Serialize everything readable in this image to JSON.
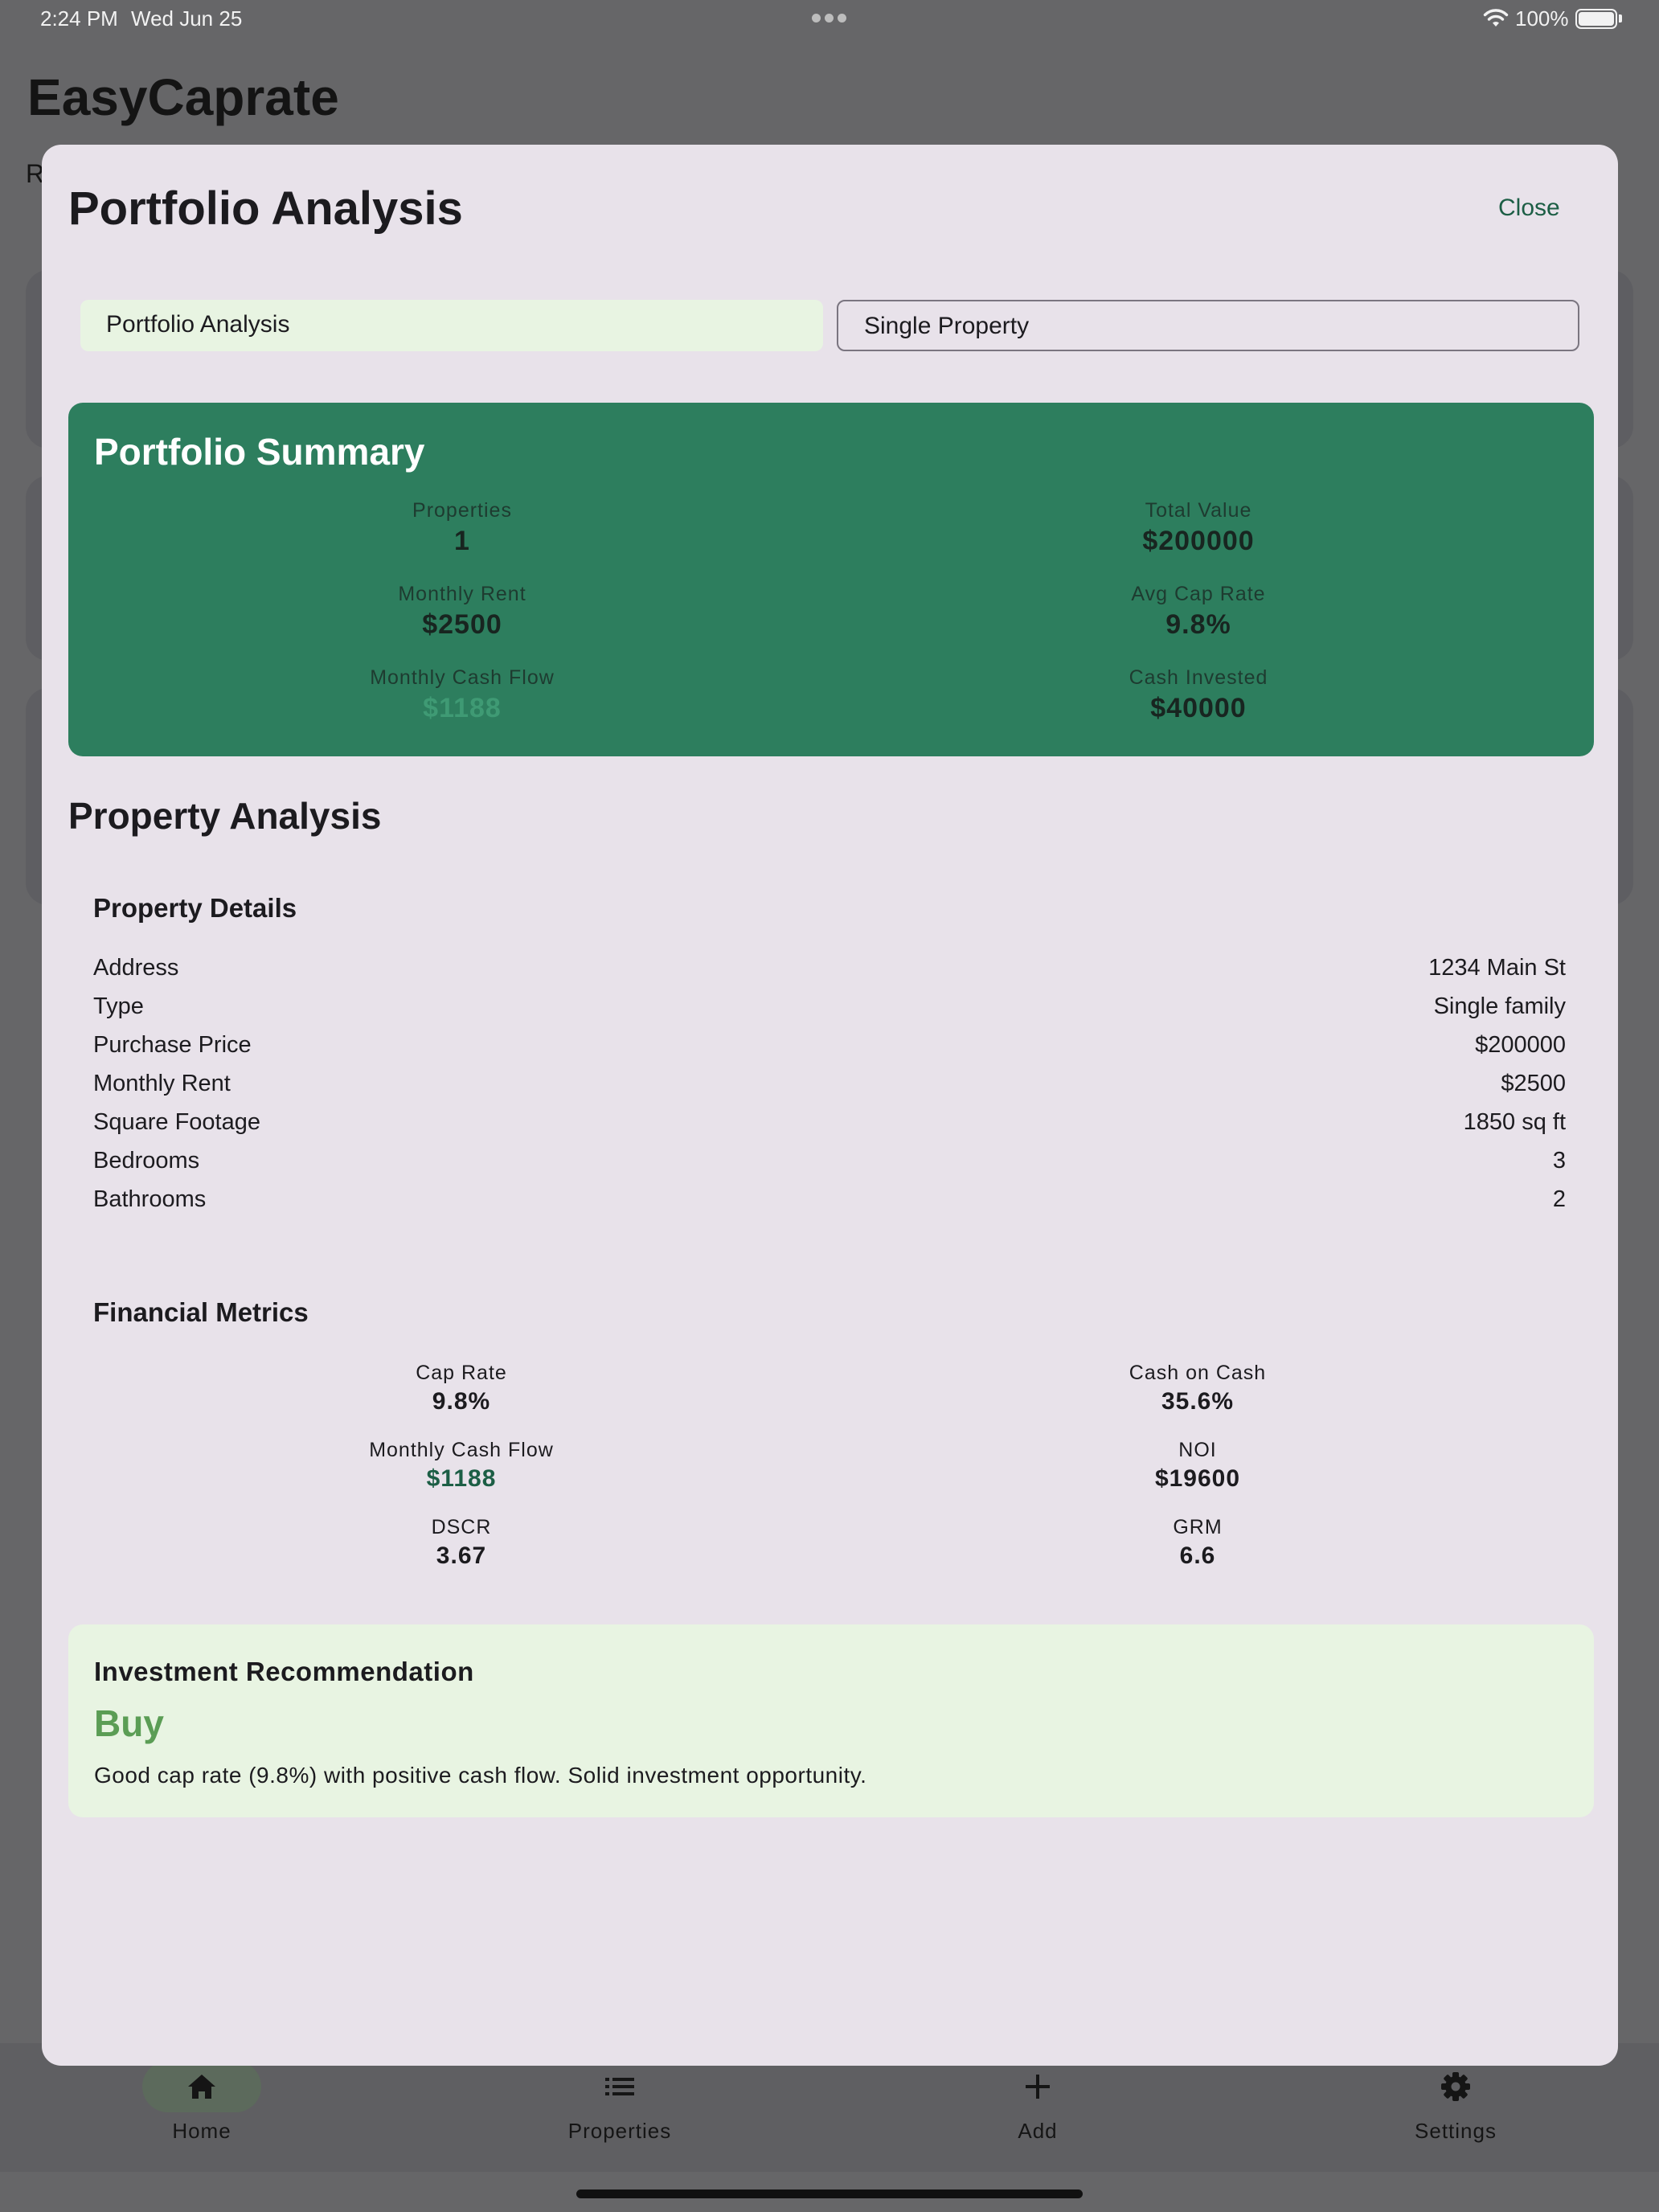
{
  "status_bar": {
    "time": "2:24 PM",
    "date": "Wed Jun 25",
    "battery": "100%"
  },
  "background": {
    "app_title": "EasyCaprate",
    "subtitle_partial": "R"
  },
  "modal": {
    "title": "Portfolio Analysis",
    "close_label": "Close",
    "segments": [
      {
        "label": "Portfolio Analysis",
        "selected": true
      },
      {
        "label": "Single Property",
        "selected": false
      }
    ]
  },
  "summary": {
    "title": "Portfolio Summary",
    "metrics": [
      {
        "label": "Properties",
        "value": "1"
      },
      {
        "label": "Total Value",
        "value": "$200000"
      },
      {
        "label": "Monthly Rent",
        "value": "$2500"
      },
      {
        "label": "Avg Cap Rate",
        "value": "9.8%"
      },
      {
        "label": "Monthly Cash Flow",
        "value": "$1188"
      },
      {
        "label": "Cash Invested",
        "value": "$40000"
      }
    ]
  },
  "property_analysis": {
    "title": "Property Analysis",
    "details_title": "Property Details",
    "details": [
      {
        "label": "Address",
        "value": "1234 Main St"
      },
      {
        "label": "Type",
        "value": "Single family"
      },
      {
        "label": "Purchase Price",
        "value": "$200000"
      },
      {
        "label": "Monthly Rent",
        "value": "$2500"
      },
      {
        "label": "Square Footage",
        "value": "1850 sq ft"
      },
      {
        "label": "Bedrooms",
        "value": "3"
      },
      {
        "label": "Bathrooms",
        "value": "2"
      }
    ],
    "metrics_title": "Financial Metrics",
    "metrics": [
      {
        "label": "Cap Rate",
        "value": "9.8%"
      },
      {
        "label": "Cash on Cash",
        "value": "35.6%"
      },
      {
        "label": "Monthly Cash Flow",
        "value": "$1188"
      },
      {
        "label": "NOI",
        "value": "$19600"
      },
      {
        "label": "DSCR",
        "value": "3.67"
      },
      {
        "label": "GRM",
        "value": "6.6"
      }
    ]
  },
  "recommendation": {
    "title": "Investment Recommendation",
    "verdict": "Buy",
    "text": "Good cap rate (9.8%) with positive cash flow. Solid investment opportunity."
  },
  "bottom_nav": [
    {
      "label": "Home",
      "icon": "home-icon",
      "selected": true
    },
    {
      "label": "Properties",
      "icon": "list-icon",
      "selected": false
    },
    {
      "label": "Add",
      "icon": "plus-icon",
      "selected": false
    },
    {
      "label": "Settings",
      "icon": "gear-icon",
      "selected": false
    }
  ],
  "colors": {
    "summary_bg": "#2d7e5e",
    "accent_green": "#1c5e45",
    "buy_green": "#5b9d55",
    "selected_segment_bg": "#e8f4e2",
    "sheet_bg": "#e8e2ea"
  }
}
